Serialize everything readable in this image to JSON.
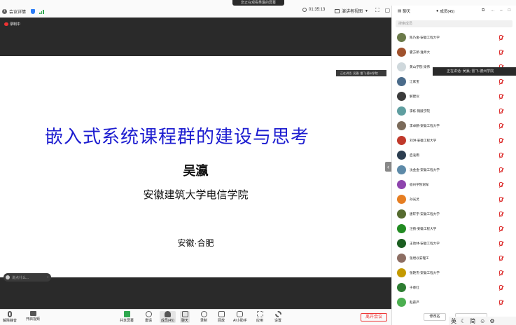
{
  "topbar": {
    "meeting_info": "会议详情",
    "now_watching": "您正在观看吴瀛的屏幕",
    "timer": "01:35:13",
    "view_mode": "演讲者视图"
  },
  "stage": {
    "recording_label": "录制中",
    "slide": {
      "title": "嵌入式系统课程群的建设与思考",
      "author": "吴瀛",
      "org": "安徽建筑大学电信学院",
      "location": "安徽·合肥"
    },
    "speaker_tip": "正在讲话: 吴瀛; 雷飞-德州学院",
    "chat_placeholder": "说点什么..."
  },
  "toolbar": {
    "unmute": "解除静音",
    "start_video": "开启视频",
    "share": "共享屏幕",
    "invite": "邀请",
    "members": "成员(45)",
    "chat": "聊天",
    "record": "录制",
    "replay": "回放",
    "ai": "AI小助手",
    "apps": "应用",
    "settings": "设置",
    "end": "离开会议"
  },
  "panel": {
    "chat_tab": "聊天",
    "members_tab": "成员(45)",
    "search_placeholder": "搜索成员",
    "speaking_tip": "正在讲话: 吴瀛; 雷飞-德州学院",
    "members": [
      {
        "name": "陈乃金-安徽工程大学",
        "color": "#6b7a4a"
      },
      {
        "name": "霍方新-淮师大",
        "color": "#a0522d"
      },
      {
        "name": "黄山学院-梁伟",
        "color": "#cfd8dc"
      },
      {
        "name": "江家宝",
        "color": "#4a6b8a"
      },
      {
        "name": "解建仪",
        "color": "#3b3b3b"
      },
      {
        "name": "李栋-铜陵学院",
        "color": "#5f9ea0"
      },
      {
        "name": "李卓鹏-安徽工程大学",
        "color": "#7b6b5a"
      },
      {
        "name": "刘洪-安徽工程大学",
        "color": "#c0392b"
      },
      {
        "name": "启凌雨",
        "color": "#2c3e50"
      },
      {
        "name": "沈金金-安徽工程大学",
        "color": "#5d8aa8"
      },
      {
        "name": "宿州学院谢军",
        "color": "#8e44ad"
      },
      {
        "name": "孙光灵",
        "color": "#e67e22"
      },
      {
        "name": "唐轩宇-安徽工程大学",
        "color": "#556b2f"
      },
      {
        "name": "汪扬-安徽工程大学",
        "color": "#228b22"
      },
      {
        "name": "王劭林-安徽工程大学",
        "color": "#1b5e20"
      },
      {
        "name": "张煜@安理工",
        "color": "#8d6e63"
      },
      {
        "name": "张艳杰-安徽工程大学",
        "color": "#c49a00"
      },
      {
        "name": "于春红",
        "color": "#2e7d32"
      },
      {
        "name": "赵森严",
        "color": "#4caf50"
      }
    ],
    "rename": "修改名"
  },
  "ime": {
    "lang": "英",
    "mode": "简"
  }
}
